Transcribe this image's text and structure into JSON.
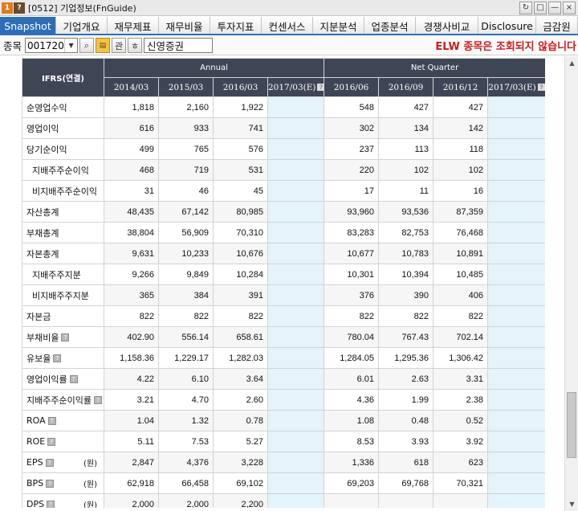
{
  "window": {
    "badge1": "1",
    "badge2": "?",
    "title": "[0512] 기업정보(FnGuide)",
    "controls": [
      "↻",
      "□",
      "—",
      "×"
    ]
  },
  "tabs": [
    "Snapshot",
    "기업개요",
    "재무제표",
    "재무비율",
    "투자지표",
    "컨센서스",
    "지분분석",
    "업종분석",
    "경쟁사비교",
    "Disclosure",
    "금감원"
  ],
  "toolbar": {
    "label": "종목",
    "code": "001720",
    "btn_search": "⌕",
    "btn_folder": "▤",
    "btn_rel": "관",
    "btn_alert": "ㅎ",
    "company": "신영증권",
    "message": "ELW 종목은 조회되지 않습니다"
  },
  "table": {
    "corner": "IFRS(연결)",
    "group_annual": "Annual",
    "group_quarter": "Net Quarter",
    "columns": [
      "2014/03",
      "2015/03",
      "2016/03",
      "2017/03(E)",
      "2016/06",
      "2016/09",
      "2016/12",
      "2017/03(E)"
    ],
    "rows": [
      {
        "label": "순영업수익",
        "sub": false,
        "info": false,
        "unit": "",
        "values": [
          "1,818",
          "2,160",
          "1,922",
          "",
          "548",
          "427",
          "427",
          ""
        ]
      },
      {
        "label": "영업이익",
        "sub": false,
        "info": false,
        "unit": "",
        "values": [
          "616",
          "933",
          "741",
          "",
          "302",
          "134",
          "142",
          ""
        ]
      },
      {
        "label": "당기순이익",
        "sub": false,
        "info": false,
        "unit": "",
        "values": [
          "499",
          "765",
          "576",
          "",
          "237",
          "113",
          "118",
          ""
        ]
      },
      {
        "label": "지배주주순이익",
        "sub": true,
        "info": false,
        "unit": "",
        "values": [
          "468",
          "719",
          "531",
          "",
          "220",
          "102",
          "102",
          ""
        ]
      },
      {
        "label": "비지배주주순이익",
        "sub": true,
        "info": false,
        "unit": "",
        "values": [
          "31",
          "46",
          "45",
          "",
          "17",
          "11",
          "16",
          ""
        ]
      },
      {
        "label": "자산총계",
        "sub": false,
        "info": false,
        "unit": "",
        "values": [
          "48,435",
          "67,142",
          "80,985",
          "",
          "93,960",
          "93,536",
          "87,359",
          ""
        ]
      },
      {
        "label": "부채총계",
        "sub": false,
        "info": false,
        "unit": "",
        "values": [
          "38,804",
          "56,909",
          "70,310",
          "",
          "83,283",
          "82,753",
          "76,468",
          ""
        ]
      },
      {
        "label": "자본총계",
        "sub": false,
        "info": false,
        "unit": "",
        "values": [
          "9,631",
          "10,233",
          "10,676",
          "",
          "10,677",
          "10,783",
          "10,891",
          ""
        ]
      },
      {
        "label": "지배주주지분",
        "sub": true,
        "info": false,
        "unit": "",
        "values": [
          "9,266",
          "9,849",
          "10,284",
          "",
          "10,301",
          "10,394",
          "10,485",
          ""
        ]
      },
      {
        "label": "비지배주주지분",
        "sub": true,
        "info": false,
        "unit": "",
        "values": [
          "365",
          "384",
          "391",
          "",
          "376",
          "390",
          "406",
          ""
        ]
      },
      {
        "label": "자본금",
        "sub": false,
        "info": false,
        "unit": "",
        "values": [
          "822",
          "822",
          "822",
          "",
          "822",
          "822",
          "822",
          ""
        ]
      },
      {
        "label": "부채비율",
        "sub": false,
        "info": true,
        "unit": "",
        "values": [
          "402.90",
          "556.14",
          "658.61",
          "",
          "780.04",
          "767.43",
          "702.14",
          ""
        ]
      },
      {
        "label": "유보율",
        "sub": false,
        "info": true,
        "unit": "",
        "values": [
          "1,158.36",
          "1,229.17",
          "1,282.03",
          "",
          "1,284.05",
          "1,295.36",
          "1,306.42",
          ""
        ]
      },
      {
        "label": "영업이익률",
        "sub": false,
        "info": true,
        "unit": "",
        "values": [
          "4.22",
          "6.10",
          "3.64",
          "",
          "6.01",
          "2.63",
          "3.31",
          ""
        ]
      },
      {
        "label": "지배주주순이익률",
        "sub": false,
        "info": true,
        "unit": "",
        "values": [
          "3.21",
          "4.70",
          "2.60",
          "",
          "4.36",
          "1.99",
          "2.38",
          ""
        ]
      },
      {
        "label": "ROA",
        "sub": false,
        "info": true,
        "unit": "",
        "values": [
          "1.04",
          "1.32",
          "0.78",
          "",
          "1.08",
          "0.48",
          "0.52",
          ""
        ]
      },
      {
        "label": "ROE",
        "sub": false,
        "info": true,
        "unit": "",
        "values": [
          "5.11",
          "7.53",
          "5.27",
          "",
          "8.53",
          "3.93",
          "3.92",
          ""
        ]
      },
      {
        "label": "EPS",
        "sub": false,
        "info": true,
        "unit": "(원)",
        "values": [
          "2,847",
          "4,376",
          "3,228",
          "",
          "1,336",
          "618",
          "623",
          ""
        ]
      },
      {
        "label": "BPS",
        "sub": false,
        "info": true,
        "unit": "(원)",
        "values": [
          "62,918",
          "66,458",
          "69,102",
          "",
          "69,203",
          "69,768",
          "70,321",
          ""
        ]
      },
      {
        "label": "DPS",
        "sub": false,
        "info": true,
        "unit": "(원)",
        "values": [
          "2,000",
          "2,000",
          "2,200",
          "",
          "",
          "",
          "",
          ""
        ]
      }
    ]
  }
}
